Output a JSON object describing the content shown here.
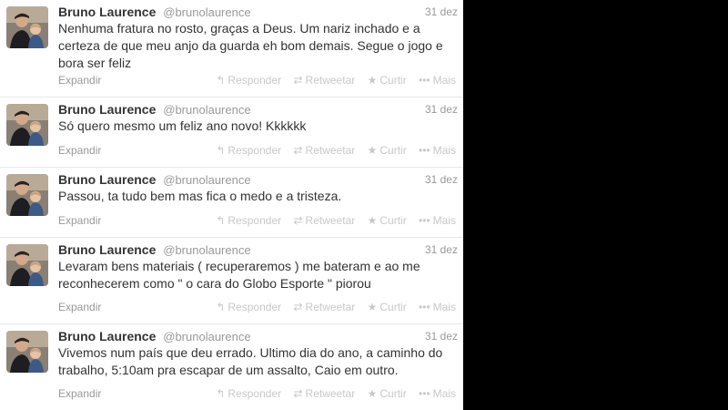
{
  "tweets": [
    {
      "name": "Bruno Laurence",
      "handle": "@brunolaurence",
      "date": "31 dez",
      "lines": [
        "Nenhuma fratura no rosto, graças a Deus. Um nariz inchado e a",
        "certeza de que meu anjo da guarda eh bom demais. Segue o jogo e",
        "bora ser feliz"
      ]
    },
    {
      "name": "Bruno Laurence",
      "handle": "@brunolaurence",
      "date": "31 dez",
      "lines": [
        "Só quero mesmo um feliz ano novo! Kkkkkk"
      ]
    },
    {
      "name": "Bruno Laurence",
      "handle": "@brunolaurence",
      "date": "31 dez",
      "lines": [
        "Passou, ta tudo bem mas fica o medo e a tristeza."
      ]
    },
    {
      "name": "Bruno Laurence",
      "handle": "@brunolaurence",
      "date": "31 dez",
      "lines": [
        "Levaram bens materiais ( recuperaremos ) me bateram e ao me",
        "reconhecerem como \" o cara do Globo Esporte \" piorou"
      ]
    },
    {
      "name": "Bruno Laurence",
      "handle": "@brunolaurence",
      "date": "31 dez",
      "lines": [
        "Vivemos num país que deu errado. Ultimo dia do ano, a caminho do",
        "trabalho, 5:10am pra escapar de um assalto, Caio em outro."
      ]
    }
  ],
  "footer": {
    "expand": "Expandir",
    "reply": "Responder",
    "retweet": "Retweetar",
    "like": "Curtir",
    "more": "Mais"
  },
  "icons": {
    "reply": "reply-arrow-icon",
    "retweet": "retweet-icon",
    "like": "star-icon",
    "more": "more-dots-icon"
  },
  "colors": {
    "name": "#333333",
    "meta": "#999999",
    "actions": "#c8c8c8",
    "separator": "#e8e8e8",
    "page_bg": "#000000"
  }
}
